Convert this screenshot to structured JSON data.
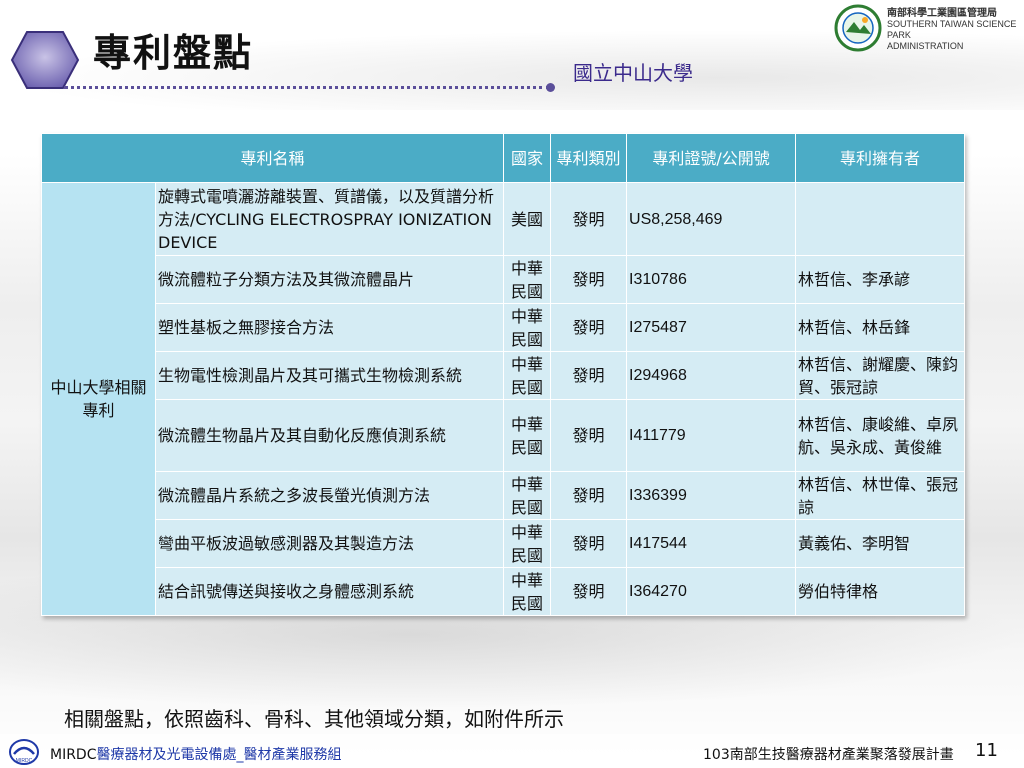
{
  "header": {
    "title": "專利盤點",
    "subtitle": "國立中山大學"
  },
  "logo": {
    "line1": "南部科學工業園區管理局",
    "line2": "SOUTHERN TAIWAN SCIENCE PARK",
    "line3": "ADMINISTRATION"
  },
  "table": {
    "headers": [
      "專利名稱",
      "國家",
      "專利類別",
      "專利證號/公開號",
      "專利擁有者"
    ],
    "group_label": "中山大學相關專利",
    "rows": [
      {
        "name": "旋轉式電噴灑游離裝置、質譜儀，以及質譜分析方法/CYCLING ELECTROSPRAY IONIZATION DEVICE",
        "country": "美國",
        "type": "發明",
        "number": "US8,258,469",
        "owner": ""
      },
      {
        "name": "微流體粒子分類方法及其微流體晶片",
        "country": "中華民國",
        "type": "發明",
        "number": "I310786",
        "owner": "林哲信、李承諺"
      },
      {
        "name": "塑性基板之無膠接合方法",
        "country": "中華民國",
        "type": "發明",
        "number": "I275487",
        "owner": "林哲信、林岳鋒"
      },
      {
        "name": "生物電性檢測晶片及其可攜式生物檢測系統",
        "country": "中華民國",
        "type": "發明",
        "number": "I294968",
        "owner": "林哲信、謝耀慶、陳鈞貿、張冠諒"
      },
      {
        "name": "微流體生物晶片及其自動化反應偵測系統",
        "country": "中華民國",
        "type": "發明",
        "number": "I411779",
        "owner": "林哲信、康峻維、卓夙航、吳永成、黃俊維"
      },
      {
        "name": "微流體晶片系統之多波長螢光偵測方法",
        "country": "中華民國",
        "type": "發明",
        "number": "I336399",
        "owner": "林哲信、林世偉、張冠諒"
      },
      {
        "name": "彎曲平板波過敏感測器及其製造方法",
        "country": "中華民國",
        "type": "發明",
        "number": "I417544",
        "owner": "黃義佑、李明智"
      },
      {
        "name": "結合訊號傳送與接收之身體感測系統",
        "country": "中華民國",
        "type": "發明",
        "number": "I364270",
        "owner": "勞伯特律格"
      }
    ]
  },
  "note": "相關盤點，依照齒科、骨科、其他領域分類，如附件所示",
  "footer": {
    "org": "MIRDC",
    "dept": "醫療器材及光電設備處_醫材產業服務組",
    "plan": "103南部生技醫療器材產業聚落發展計畫",
    "page": "11",
    "mirdc_logo_text": "MIRDC"
  },
  "colors": {
    "header_bg": "#4bacc6",
    "row_bg": "#d5ecf4",
    "accent_purple": "#5b4f9a",
    "footer_blue": "#1f39a8"
  }
}
